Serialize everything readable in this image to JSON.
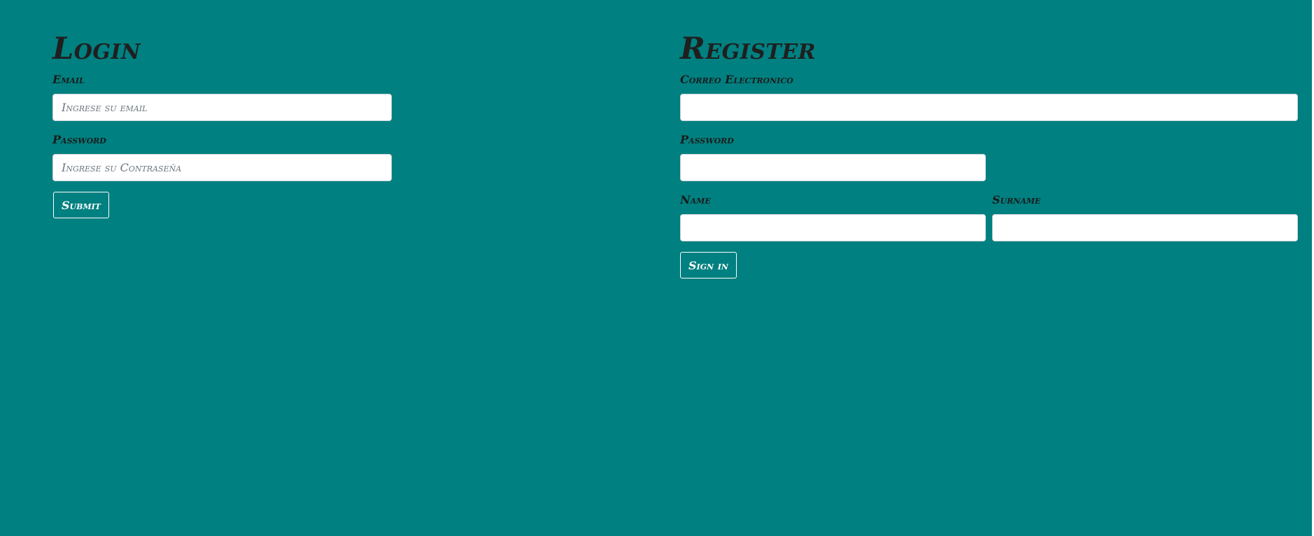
{
  "login": {
    "title": "Login",
    "email_label": "Email",
    "email_placeholder": "Ingrese su email",
    "email_value": "",
    "password_label": "Password",
    "password_placeholder": "Ingrese su Contraseña",
    "password_value": "",
    "submit_label": "Submit"
  },
  "register": {
    "title": "Register",
    "email_label": "Correo Electronico",
    "email_value": "",
    "password_label": "Password",
    "password_value": "",
    "name_label": "Name",
    "name_value": "",
    "surname_label": "Surname",
    "surname_value": "",
    "signin_label": "Sign in"
  },
  "colors": {
    "background": "#008080",
    "text": "#1f1f1f",
    "button_border": "#ffffff"
  }
}
